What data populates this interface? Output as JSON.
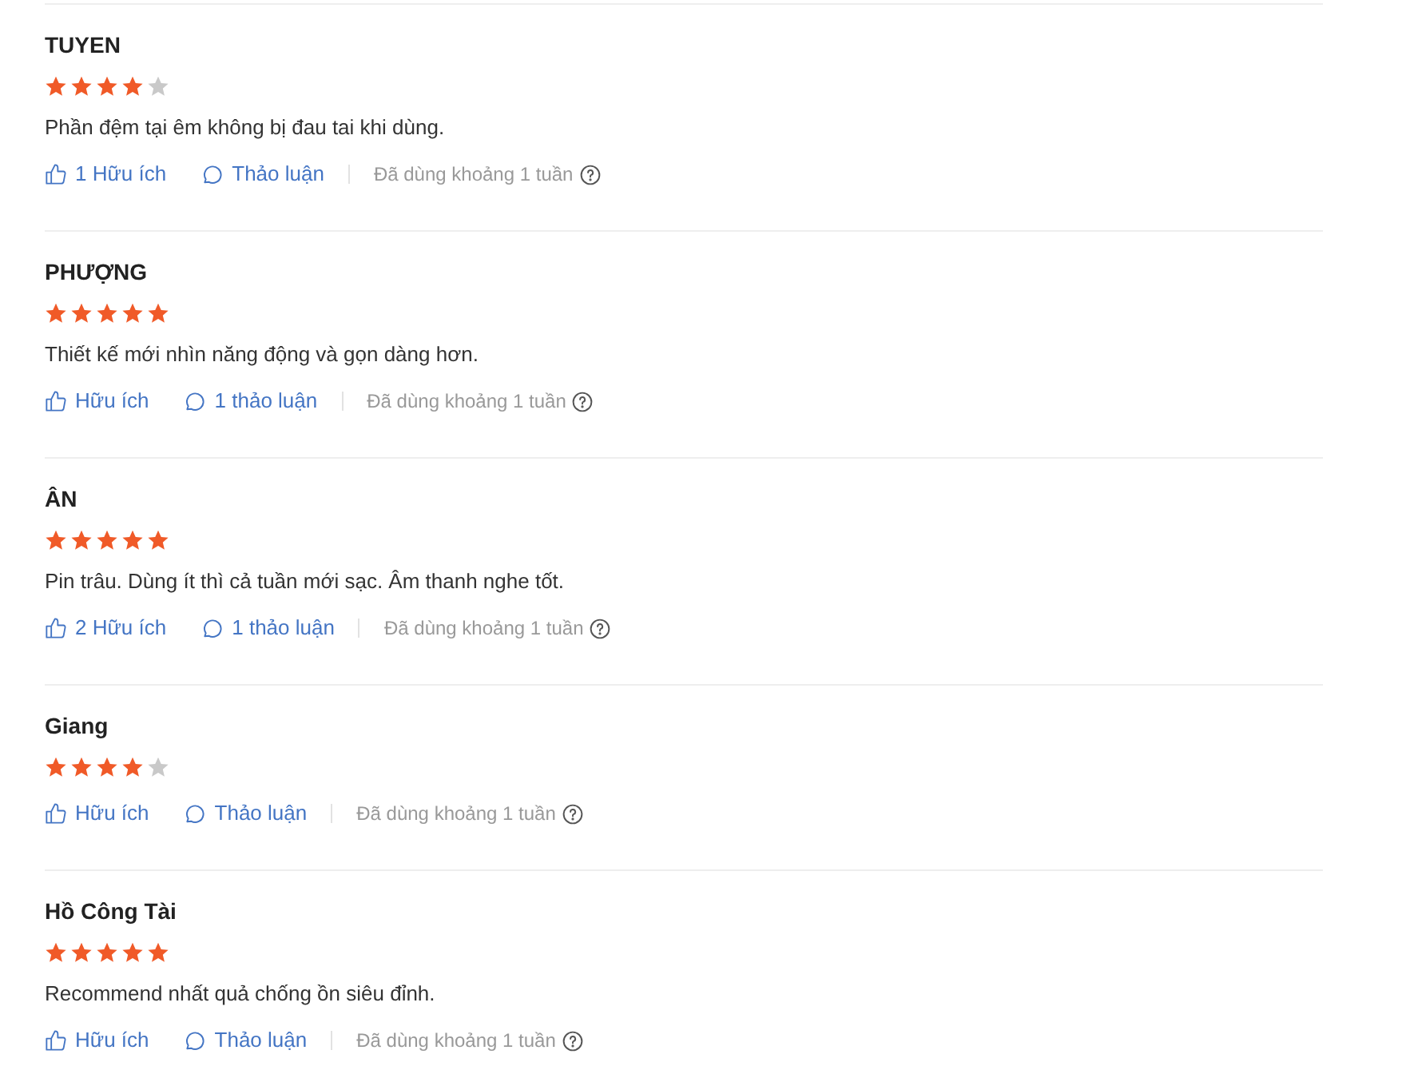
{
  "reviews": [
    {
      "name": "TUYEN",
      "stars": 4,
      "text": "Phần đệm tại êm không bị đau tai khi dùng.",
      "helpful": "1 Hữu ích",
      "discussion": "Thảo luận",
      "usage": "Đã dùng khoảng 1 tuần"
    },
    {
      "name": "PHƯỢNG",
      "stars": 5,
      "text": "Thiết kế mới nhìn năng động và gọn dàng hơn.",
      "helpful": "Hữu ích",
      "discussion": "1 thảo luận",
      "usage": "Đã dùng khoảng 1 tuần"
    },
    {
      "name": "ÂN",
      "stars": 5,
      "text": "Pin trâu. Dùng ít thì cả tuần mới sạc. Âm thanh nghe tốt.",
      "helpful": "2 Hữu ích",
      "discussion": "1 thảo luận",
      "usage": "Đã dùng khoảng 1 tuần"
    },
    {
      "name": "Giang",
      "stars": 4,
      "helpful": "Hữu ích",
      "discussion": "Thảo luận",
      "usage": "Đã dùng khoảng 1 tuần"
    },
    {
      "name": "Hồ Công Tài",
      "stars": 5,
      "text": "Recommend nhất quả chống ồn siêu đỉnh.",
      "helpful": "Hữu ích",
      "discussion": "Thảo luận",
      "usage": "Đã dùng khoảng 1 tuần"
    }
  ]
}
